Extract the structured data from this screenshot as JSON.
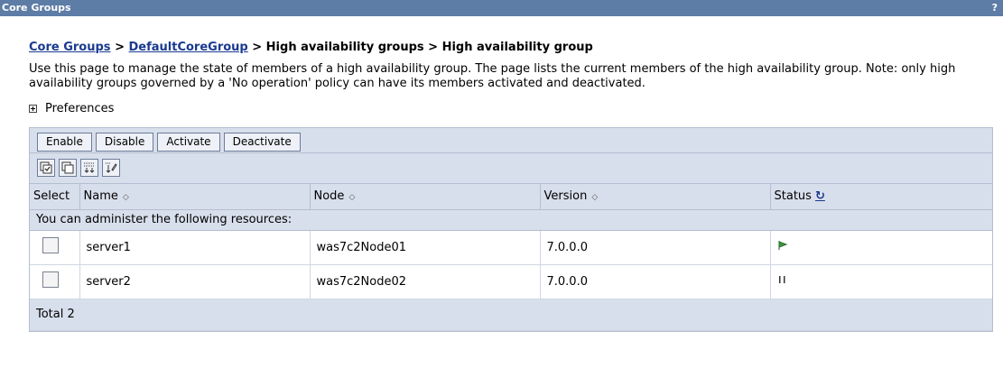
{
  "window": {
    "title": "Core Groups",
    "help": "?"
  },
  "breadcrumb": {
    "link1": "Core Groups",
    "sep": " > ",
    "link2": "DefaultCoreGroup",
    "rest": " > High availability groups > High availability group"
  },
  "description": "Use this page to manage the state of members of a high availability group. The page lists the current members of the high availability group. Note: only high availability groups governed by a 'No operation' policy can have its members activated and deactivated.",
  "preferences": "Preferences",
  "toolbar": {
    "enable": "Enable",
    "disable": "Disable",
    "activate": "Activate",
    "deactivate": "Deactivate"
  },
  "icons": [
    "select-all-icon",
    "deselect-all-icon",
    "show-filter-icon",
    "clear-filter-icon"
  ],
  "table": {
    "headers": {
      "select": "Select",
      "name": "Name",
      "node": "Node",
      "version": "Version",
      "status": "Status"
    },
    "info": "You can administer the following resources:",
    "rows": [
      {
        "name": "server1",
        "node": "was7c2Node01",
        "version": "7.0.0.0",
        "status": "started-flag-icon"
      },
      {
        "name": "server2",
        "node": "was7c2Node02",
        "version": "7.0.0.0",
        "status": "paused-icon"
      }
    ],
    "total": "Total 2"
  },
  "colors": {
    "titlebar": "#5d7ca6",
    "panel": "#d8dfec",
    "link": "#1a3a8f"
  }
}
